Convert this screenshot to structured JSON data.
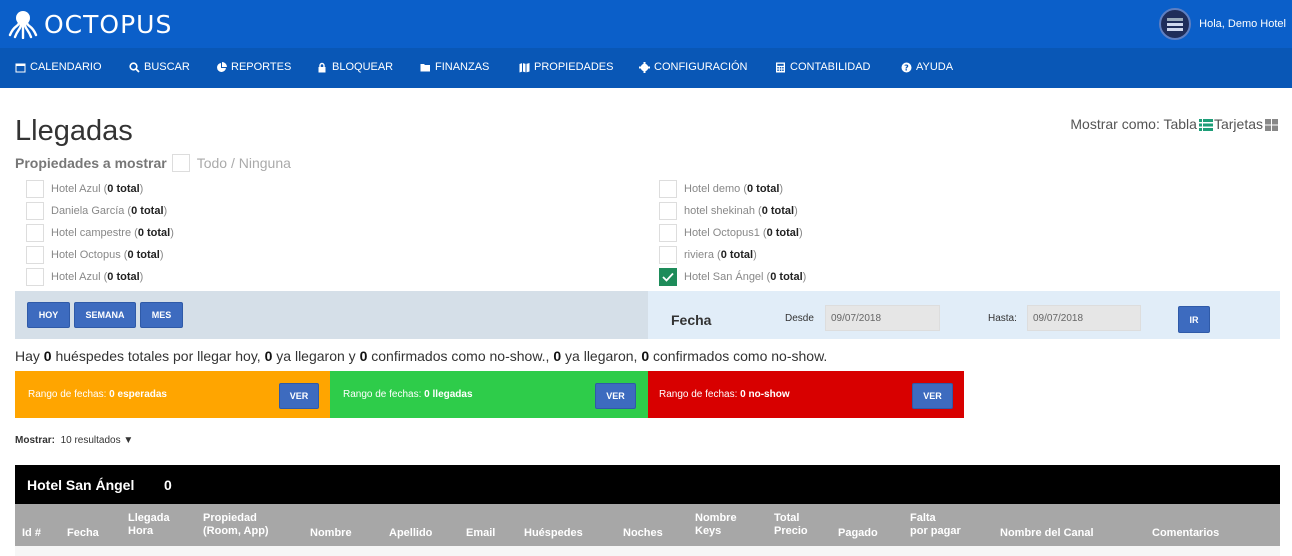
{
  "app": {
    "logo_text": "OCTOPUS",
    "greeting": "Hola, Demo Hotel"
  },
  "nav": [
    {
      "label": "CALENDARIO",
      "icon": "calendar-icon"
    },
    {
      "label": "BUSCAR",
      "icon": "search-icon"
    },
    {
      "label": "REPORTES",
      "icon": "pie-chart-icon"
    },
    {
      "label": "BLOQUEAR",
      "icon": "lock-icon"
    },
    {
      "label": "FINANZAS",
      "icon": "folder-icon"
    },
    {
      "label": "PROPIEDADES",
      "icon": "map-icon"
    },
    {
      "label": "CONFIGURACIÓN",
      "icon": "gear-icon"
    },
    {
      "label": "CONTABILIDAD",
      "icon": "calculator-icon"
    },
    {
      "label": "AYUDA",
      "icon": "help-icon"
    }
  ],
  "page": {
    "title": "Llegadas",
    "show_as_label": "Mostrar como: Tabla",
    "show_as_cards": "Tarjetas",
    "properties_label": "Propiedades a mostrar",
    "all_none": "Todo / Ninguna"
  },
  "properties": [
    {
      "name": "Hotel Azul",
      "total": "0 total",
      "checked": false
    },
    {
      "name": "Daniela García",
      "total": "0 total",
      "checked": false
    },
    {
      "name": "Hotel campestre",
      "total": "0 total",
      "checked": false
    },
    {
      "name": "Hotel Octopus",
      "total": "0 total",
      "checked": false
    },
    {
      "name": "Hotel Azul",
      "total": "0 total",
      "checked": false
    },
    {
      "name": "Hotel demo",
      "total": "0 total",
      "checked": false
    },
    {
      "name": "hotel shekinah",
      "total": "0 total",
      "checked": false
    },
    {
      "name": "Hotel Octopus1",
      "total": "0 total",
      "checked": false
    },
    {
      "name": "riviera",
      "total": "0 total",
      "checked": false
    },
    {
      "name": "Hotel San Ángel",
      "total": "0 total",
      "checked": true
    }
  ],
  "filters": {
    "hoy": "HOY",
    "semana": "SEMANA",
    "mes": "MES",
    "fecha_label": "Fecha",
    "desde_label": "Desde",
    "desde_value": "09/07/2018",
    "hasta_label": "Hasta:",
    "hasta_value": "09/07/2018",
    "go": "IR"
  },
  "summary": {
    "p1": "Hay ",
    "n1": "0",
    "p2": " huéspedes totales por llegar hoy, ",
    "n2": "0",
    "p3": " ya llegaron y ",
    "n3": "0",
    "p4": " confirmados como no-show., ",
    "n4": "0",
    "p5": " ya llegaron, ",
    "n5": "0",
    "p6": " confirmados como no-show."
  },
  "cards": [
    {
      "prefix": "Rango de fechas: ",
      "value": "0 esperadas",
      "button": "VER",
      "color": "#ffa500"
    },
    {
      "prefix": "Rango de fechas: ",
      "value": "0 llegadas",
      "button": "VER",
      "color": "#2ecc4a"
    },
    {
      "prefix": "Rango de fechas: ",
      "value": "0 no-show",
      "button": "VER",
      "color": "#d80000"
    }
  ],
  "results": {
    "label": "Mostrar:",
    "value": "10 resultados",
    "caret": "▼"
  },
  "hotel": {
    "name": "Hotel San Ángel",
    "count": "0"
  },
  "columns": [
    [
      "Id #"
    ],
    [
      "Fecha"
    ],
    [
      "Llegada",
      "Hora"
    ],
    [
      "Propiedad",
      "(Room, App)"
    ],
    [
      "Nombre"
    ],
    [
      "Apellido"
    ],
    [
      "Email"
    ],
    [
      "Huéspedes"
    ],
    [
      "Noches"
    ],
    [
      "Nombre",
      "Keys"
    ],
    [
      "Total",
      "Precio"
    ],
    [
      "Pagado"
    ],
    [
      "Falta",
      "por pagar"
    ],
    [
      "Nombre del Canal"
    ],
    [
      "Comentarios"
    ]
  ]
}
